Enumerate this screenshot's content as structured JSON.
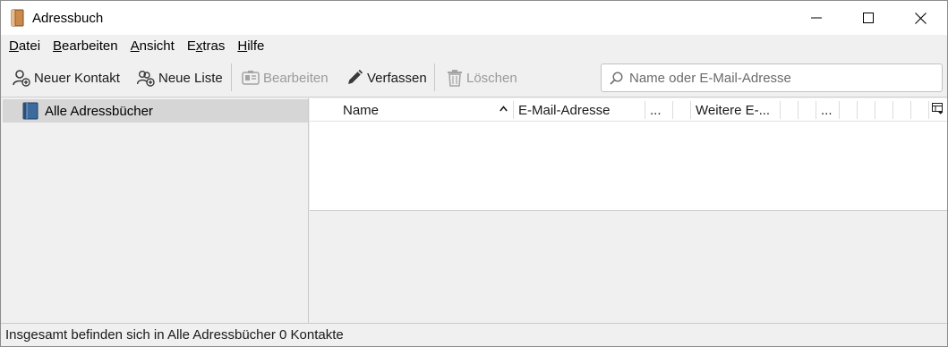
{
  "window": {
    "title": "Adressbuch",
    "controls": {
      "minimize": "minimize-icon",
      "maximize": "maximize-icon",
      "close": "close-icon"
    }
  },
  "menubar": {
    "items": [
      {
        "label": "Datei",
        "accel": "D",
        "rest": "atei"
      },
      {
        "label": "Bearbeiten",
        "accel": "B",
        "rest": "earbeiten"
      },
      {
        "label": "Ansicht",
        "accel": "A",
        "rest": "nsicht"
      },
      {
        "label": "Extras",
        "pre": "E",
        "accel": "x",
        "rest": "tras"
      },
      {
        "label": "Hilfe",
        "accel": "H",
        "rest": "ilfe"
      }
    ]
  },
  "toolbar": {
    "new_contact": "Neuer Kontakt",
    "new_list": "Neue Liste",
    "edit": "Bearbeiten",
    "compose": "Verfassen",
    "delete": "Löschen",
    "search_placeholder": "Name oder E-Mail-Adresse",
    "search_value": ""
  },
  "sidebar": {
    "items": [
      {
        "label": "Alle Adressbücher",
        "icon": "address-book-icon",
        "selected": true
      }
    ]
  },
  "results": {
    "columns": [
      "Name",
      "E-Mail-Adresse",
      "...",
      "",
      "Weitere E-...",
      "",
      "",
      "...",
      "",
      "",
      "",
      "",
      ""
    ],
    "sort_column": "Name",
    "sort_direction": "ascending",
    "rows": []
  },
  "status": {
    "text": "Insgesamt befinden sich in Alle Adressbücher 0 Kontakte"
  },
  "colors": {
    "chrome": "#f0f0f0",
    "selection": "#d6d6d6",
    "disabled_text": "#9a9a9a"
  }
}
